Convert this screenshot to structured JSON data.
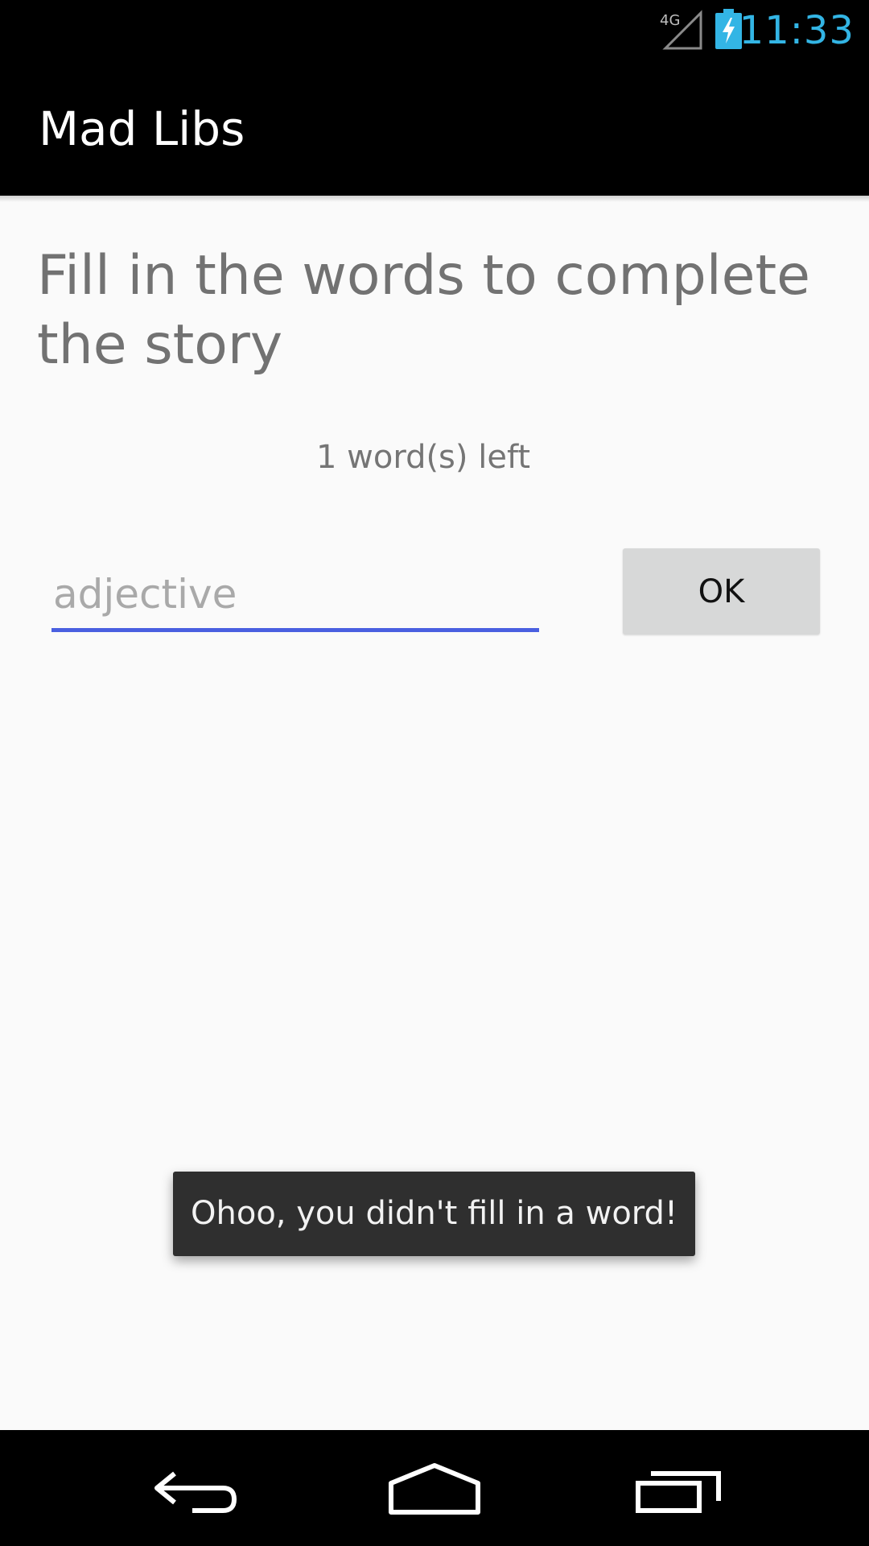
{
  "status_bar": {
    "network_type": "4G",
    "time": "11:33",
    "signal_icon": "signal-4g-icon",
    "battery_icon": "battery-charging-icon",
    "time_color": "#33b5e5"
  },
  "action_bar": {
    "title": "Mad Libs"
  },
  "main": {
    "heading": "Fill in the words to complete the story",
    "words_left": "1 word(s) left",
    "word_input": {
      "value": "",
      "placeholder": "adjective",
      "underline_color": "#4a5fe0"
    },
    "ok_button_label": "OK"
  },
  "toast": {
    "message": "Ohoo, you didn't fill in a word!"
  },
  "nav_bar": {
    "back_icon": "back-icon",
    "home_icon": "home-icon",
    "recents_icon": "recents-icon"
  }
}
